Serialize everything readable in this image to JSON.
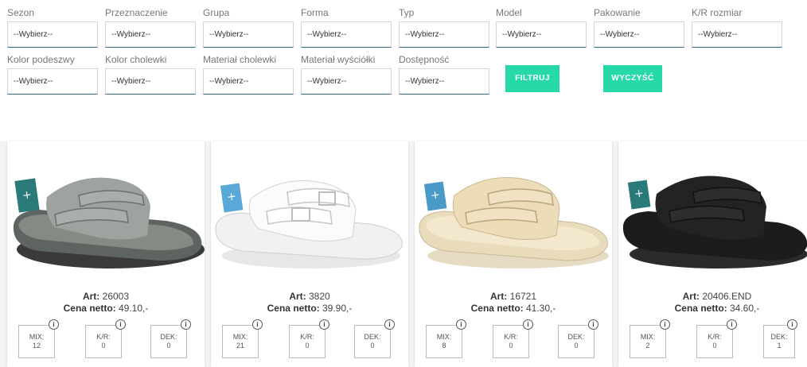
{
  "filters": {
    "row1": [
      {
        "label": "Sezon",
        "value": "--Wybierz--"
      },
      {
        "label": "Przeznaczenie",
        "value": "--Wybierz--"
      },
      {
        "label": "Grupa",
        "value": "--Wybierz--"
      },
      {
        "label": "Forma",
        "value": "--Wybierz--"
      },
      {
        "label": "Typ",
        "value": "--Wybierz--"
      },
      {
        "label": "Model",
        "value": "--Wybierz--"
      },
      {
        "label": "Pakowanie",
        "value": "--Wybierz--"
      },
      {
        "label": "K/R rozmiar",
        "value": "--Wybierz--"
      }
    ],
    "row2": [
      {
        "label": "Kolor podeszwy",
        "value": "--Wybierz--"
      },
      {
        "label": "Kolor cholewki",
        "value": "--Wybierz--"
      },
      {
        "label": "Materiał cholewki",
        "value": "--Wybierz--"
      },
      {
        "label": "Materiał wyściółki",
        "value": "--Wybierz--"
      },
      {
        "label": "Dostępność",
        "value": "--Wybierz--"
      }
    ],
    "filter_button": "FILTRUJ",
    "clear_button": "WYCZYŚĆ"
  },
  "products": [
    {
      "art_label": "Art:",
      "art": "26003",
      "price_label": "Cena netto:",
      "price": "49.10,-",
      "mix_label": "MIX:",
      "mix": "12",
      "kr_label": "K/R:",
      "kr": "0",
      "dek_label": "DEK:",
      "dek": "0",
      "color": "grey"
    },
    {
      "art_label": "Art:",
      "art": "3820",
      "price_label": "Cena netto:",
      "price": "39.90,-",
      "mix_label": "MIX:",
      "mix": "21",
      "kr_label": "K/R:",
      "kr": "0",
      "dek_label": "DEK:",
      "dek": "0",
      "color": "white"
    },
    {
      "art_label": "Art:",
      "art": "16721",
      "price_label": "Cena netto:",
      "price": "41.30,-",
      "mix_label": "MIX:",
      "mix": "8",
      "kr_label": "K/R:",
      "kr": "0",
      "dek_label": "DEK:",
      "dek": "0",
      "color": "beige"
    },
    {
      "art_label": "Art:",
      "art": "20406.END",
      "price_label": "Cena netto:",
      "price": "34.60,-",
      "mix_label": "MIX:",
      "mix": "2",
      "kr_label": "K/R:",
      "kr": "0",
      "dek_label": "DEK:",
      "dek": "1",
      "color": "black"
    }
  ],
  "info_glyph": "i",
  "colors": {
    "accent": "#26d9a6",
    "select_underline": "#2f6a8a"
  }
}
